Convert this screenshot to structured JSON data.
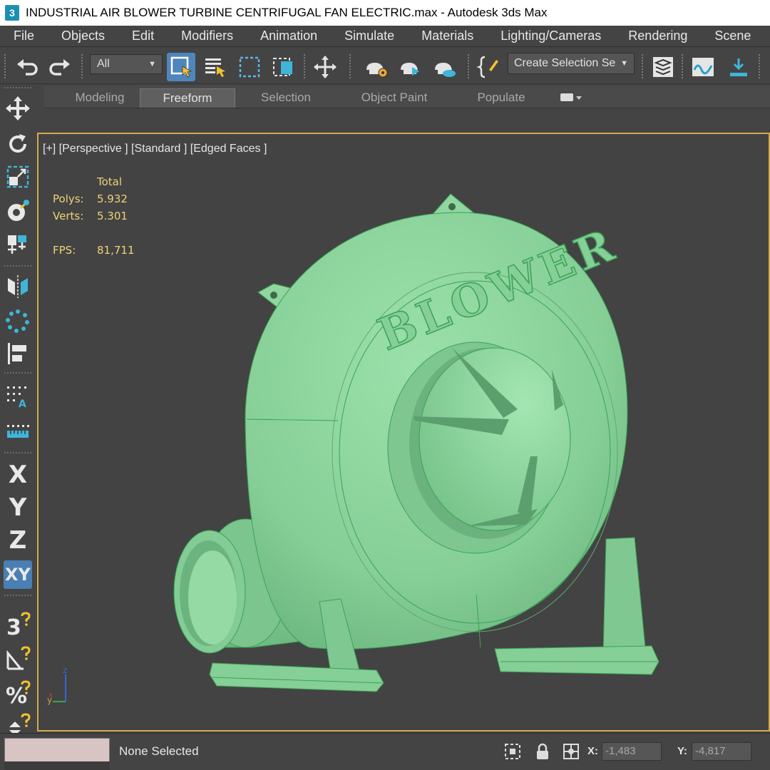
{
  "window": {
    "app_icon": "3",
    "title": "INDUSTRIAL AIR BLOWER TURBINE CENTRIFUGAL FAN ELECTRIC.max - Autodesk 3ds Max"
  },
  "menu": [
    "File",
    "Objects",
    "Edit",
    "Modifiers",
    "Animation",
    "Simulate",
    "Materials",
    "Lighting/Cameras",
    "Rendering",
    "Scene"
  ],
  "toolbar": {
    "selection_filter": "All",
    "selection_set_placeholder": "Create Selection Se",
    "icons": [
      "undo-icon",
      "redo-icon",
      "select-object-icon",
      "select-by-name-icon",
      "rectangular-selection-region-icon",
      "window-crossing-icon",
      "select-and-move-icon",
      "render-setup-icon",
      "rendered-frame-window-icon",
      "render-production-icon",
      "edit-named-selection-icon",
      "scene-explorer-icon",
      "curve-editor-icon",
      "toggle-ribbon-icon"
    ]
  },
  "ribbon": {
    "tabs": [
      "Modeling",
      "Freeform",
      "Selection",
      "Object Paint",
      "Populate"
    ],
    "active_tab": "Freeform"
  },
  "left_toolbar": {
    "icons": [
      "move-icon",
      "rotate-icon",
      "scale-icon",
      "place-icon",
      "snap-icon",
      "mirror-icon",
      "array-icon",
      "align-icon",
      "spacing-icon",
      "measure-icon"
    ],
    "axes": [
      "X",
      "Y",
      "Z",
      "XY"
    ],
    "bottom_icons": [
      "snap-3d-icon",
      "angle-snap-icon",
      "percent-snap-icon",
      "spinner-snap-icon"
    ],
    "snap_3d_label": "3"
  },
  "viewport": {
    "label": "[+] [Perspective ] [Standard ] [Edged Faces ]",
    "stats": {
      "header": "Total",
      "polys_label": "Polys:",
      "polys_value": "5.932",
      "verts_label": "Verts:",
      "verts_value": "5.301",
      "fps_label": "FPS:",
      "fps_value": "81,711"
    },
    "model_text": "BLOWER",
    "model_color": "#8cd49c",
    "gizmo": {
      "x": "x",
      "y": "y",
      "z": "z"
    }
  },
  "statusbar": {
    "status": "None Selected",
    "x_label": "X:",
    "x_value": "-1,483",
    "y_label": "Y:",
    "y_value": "-4,817"
  },
  "colors": {
    "ui_background": "#444444",
    "viewport_border": "#d6a94a",
    "stats_text": "#efd27a",
    "active_axis": "#4a7fb3"
  }
}
